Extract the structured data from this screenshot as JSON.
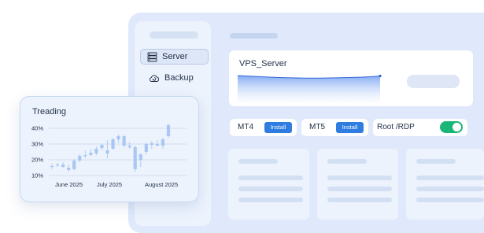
{
  "sidebar": {
    "items": [
      {
        "label": "Server",
        "icon": "server-icon"
      },
      {
        "label": "Backup",
        "icon": "backup-icon"
      }
    ]
  },
  "vps_card": {
    "title": "VPS_Server"
  },
  "options": {
    "mt4": {
      "label": "MT4",
      "button": "Install"
    },
    "mt5": {
      "label": "MT5",
      "button": "Install"
    },
    "root": {
      "label": "Root /RDP",
      "toggle_on": true
    }
  },
  "colors": {
    "accent": "#2f7de0",
    "toggle_on": "#1ab678",
    "candle": "#a9c7f2",
    "background": "#dfe9fb"
  },
  "chart_data": {
    "type": "candlestick",
    "title": "Treading",
    "y_ticks": [
      "40%",
      "30%",
      "20%",
      "10%"
    ],
    "ylim": [
      10,
      40
    ],
    "x_ticks": [
      "June 2025",
      "July 2025",
      "August 2025"
    ],
    "grid": true,
    "candles": [
      {
        "o": 15.5,
        "h": 17.5,
        "l": 14.0,
        "c": 16.0
      },
      {
        "o": 16.5,
        "h": 18.0,
        "l": 15.5,
        "c": 17.0
      },
      {
        "o": 17.0,
        "h": 18.5,
        "l": 15.0,
        "c": 15.5
      },
      {
        "o": 15.0,
        "h": 17.0,
        "l": 12.5,
        "c": 13.5
      },
      {
        "o": 14.0,
        "h": 20.5,
        "l": 13.5,
        "c": 19.5
      },
      {
        "o": 19.5,
        "h": 23.5,
        "l": 18.5,
        "c": 22.5
      },
      {
        "o": 22.5,
        "h": 26.0,
        "l": 21.0,
        "c": 23.0
      },
      {
        "o": 23.0,
        "h": 27.0,
        "l": 22.5,
        "c": 24.5
      },
      {
        "o": 24.0,
        "h": 28.5,
        "l": 23.0,
        "c": 27.0
      },
      {
        "o": 27.5,
        "h": 30.0,
        "l": 26.0,
        "c": 29.5
      },
      {
        "o": 26.0,
        "h": 32.5,
        "l": 21.0,
        "c": 24.0
      },
      {
        "o": 27.0,
        "h": 34.0,
        "l": 26.5,
        "c": 33.0
      },
      {
        "o": 33.0,
        "h": 36.0,
        "l": 31.0,
        "c": 35.0
      },
      {
        "o": 35.0,
        "h": 35.5,
        "l": 28.0,
        "c": 29.0
      },
      {
        "o": 29.0,
        "h": 31.0,
        "l": 27.0,
        "c": 28.0
      },
      {
        "o": 28.0,
        "h": 29.0,
        "l": 12.0,
        "c": 14.0
      },
      {
        "o": 20.0,
        "h": 24.0,
        "l": 15.5,
        "c": 23.5
      },
      {
        "o": 25.0,
        "h": 31.0,
        "l": 23.5,
        "c": 30.0
      },
      {
        "o": 29.5,
        "h": 32.0,
        "l": 27.0,
        "c": 30.5
      },
      {
        "o": 30.0,
        "h": 32.5,
        "l": 28.5,
        "c": 29.0
      },
      {
        "o": 29.0,
        "h": 34.0,
        "l": 27.0,
        "c": 33.0
      },
      {
        "o": 35.0,
        "h": 43.0,
        "l": 34.0,
        "c": 42.0
      }
    ]
  }
}
